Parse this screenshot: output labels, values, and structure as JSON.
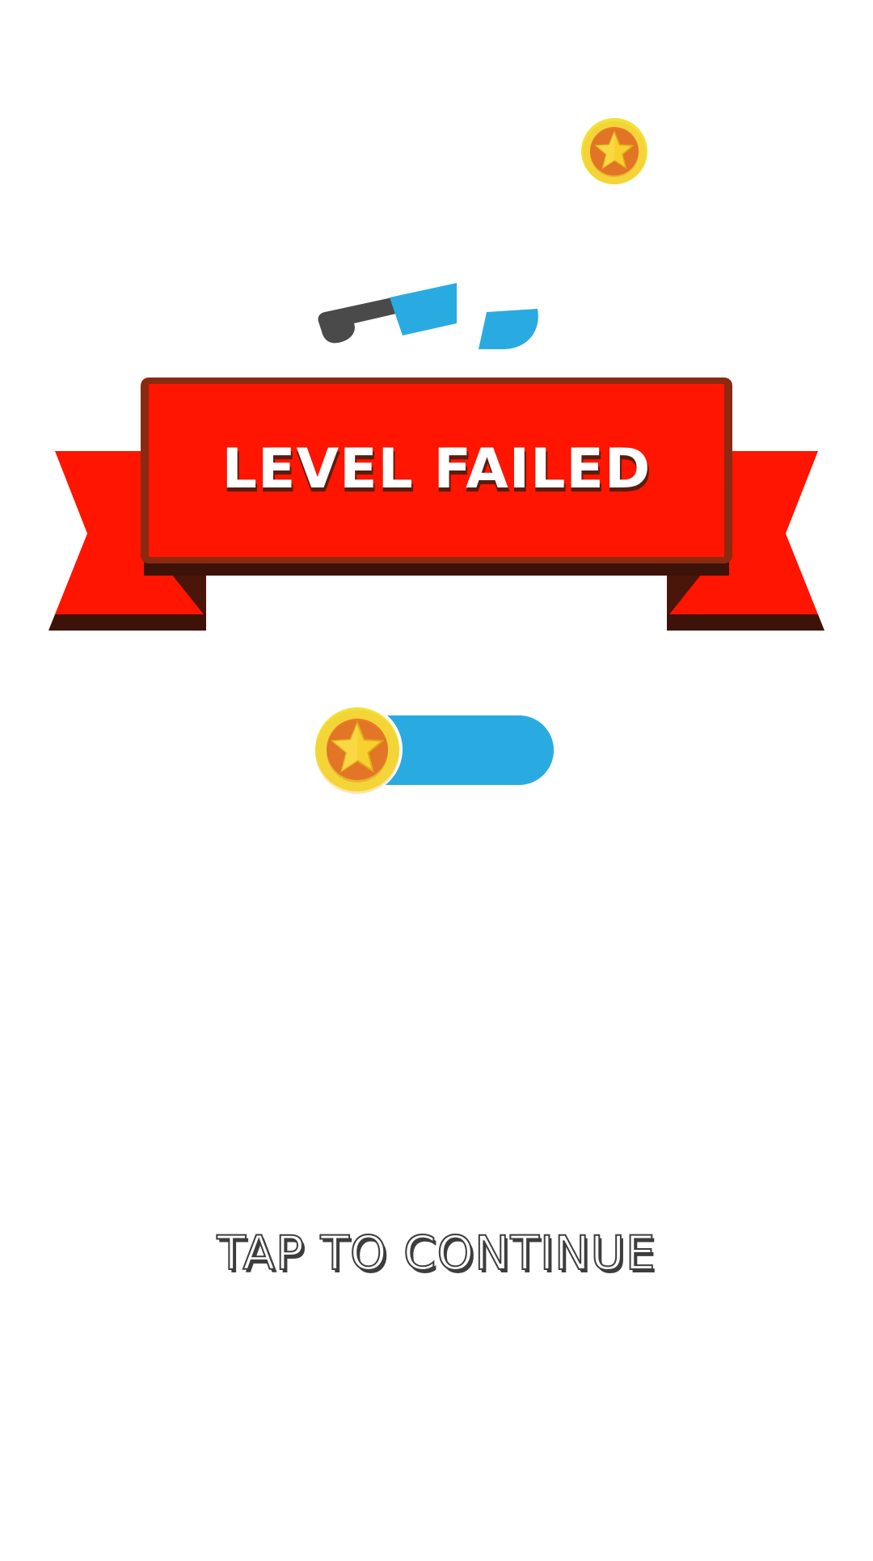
{
  "banner": {
    "title": "LEVEL FAILED"
  },
  "progress": {
    "fill_fraction": 1.0
  },
  "actions": {
    "continue_label": "TAP TO CONTINUE"
  },
  "icons": {
    "floating_coin": "coin-star-icon",
    "progress_coin": "coin-star-icon",
    "broken_item": "broken-knife-icon"
  },
  "colors": {
    "background": "#ffffff",
    "ribbon_red": "#ff1500",
    "ribbon_border": "#8a2a12",
    "ribbon_shadow": "#3d1208",
    "progress_blue": "#29abe2",
    "coin_outer": "#f2e234",
    "coin_inner": "#e97a2a",
    "star": "#f7d12e"
  }
}
